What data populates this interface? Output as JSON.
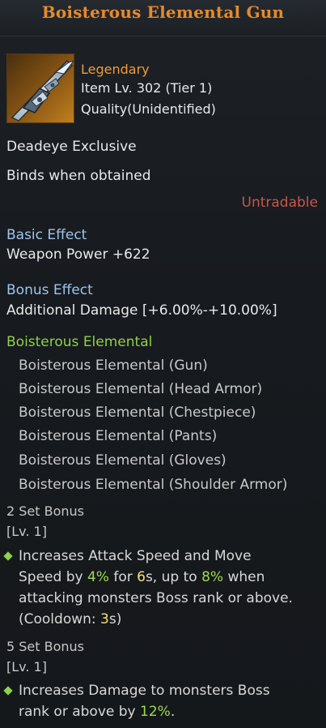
{
  "item": {
    "name": "Boisterous Elemental Gun",
    "grade": "Legendary",
    "item_level": "Item Lv. 302 (Tier 1)",
    "quality": "Quality(Unidentified)",
    "class_restriction": "Deadeye Exclusive",
    "bind": "Binds when obtained",
    "tradable": "Untradable",
    "icon": "gun-icon"
  },
  "basic_effect": {
    "header": "Basic Effect",
    "value": "Weapon Power +622"
  },
  "bonus_effect": {
    "header": "Bonus Effect",
    "value": "Additional Damage [+6.00%-+10.00%]"
  },
  "set": {
    "name": "Boisterous Elemental",
    "pieces": [
      "Boisterous Elemental (Gun)",
      "Boisterous Elemental (Head Armor)",
      "Boisterous Elemental (Chestpiece)",
      "Boisterous Elemental (Pants)",
      "Boisterous Elemental (Gloves)",
      "Boisterous Elemental (Shoulder Armor)"
    ],
    "bonus2": {
      "title": "2 Set Bonus",
      "level": "[Lv. 1]",
      "t1": "Increases Attack Speed and Move",
      "t2": "Speed by ",
      "v1": "4%",
      "t3": " for ",
      "v2": "6",
      "t4": "s, up to ",
      "v3": "8%",
      "t5": " when",
      "t6": "attacking monsters Boss rank or above.",
      "t7": "(Cooldown: ",
      "v4": "3",
      "t8": "s)"
    },
    "bonus5": {
      "title": "5 Set Bonus",
      "level": "[Lv. 1]",
      "t1": "Increases Damage to monsters Boss",
      "t2": "rank or above by ",
      "v1": "12%",
      "t3": "."
    }
  },
  "colors": {
    "title": "#e58a2b",
    "legendary": "#f09a3c",
    "header_blue": "#9ec4ea",
    "set_green": "#8ed14a",
    "untradable_red": "#c8564b"
  }
}
